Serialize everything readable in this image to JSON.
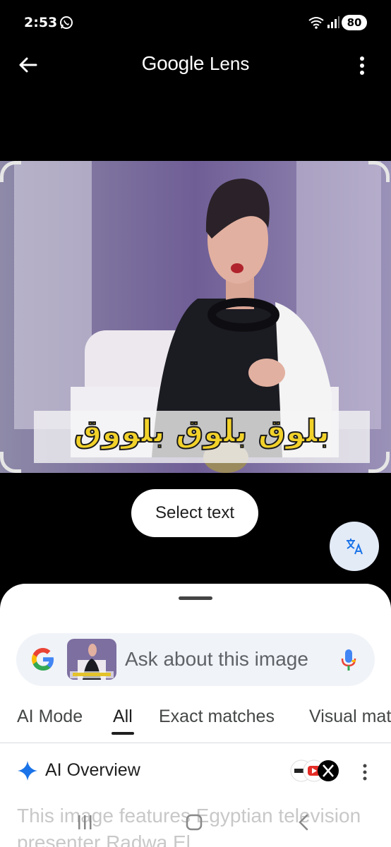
{
  "status_bar": {
    "time": "2:53",
    "battery": "80"
  },
  "app_bar": {
    "title_brand": "Google",
    "title_product": "Lens"
  },
  "image": {
    "caption": "بلوق بلوق بلووق"
  },
  "select_text_label": "Select text",
  "search": {
    "placeholder": "Ask about this image"
  },
  "tabs": [
    {
      "label": "AI Mode",
      "active": false
    },
    {
      "label": "All",
      "active": true
    },
    {
      "label": "Exact matches",
      "active": false
    },
    {
      "label": "Visual matches",
      "active": false
    }
  ],
  "ai_overview": {
    "title": "AI Overview",
    "text": "This image features Egyptian television presenter Radwa El"
  },
  "colors": {
    "accent_blue": "#1a73e8",
    "sheet_bg": "#ffffff",
    "search_bg": "#f0f3f8",
    "caption_yellow": "#f2d22a"
  },
  "icons": [
    "whatsapp-icon",
    "wifi-icon",
    "signal-icon",
    "back-arrow-icon",
    "more-vert-icon",
    "translate-icon",
    "google-g-icon",
    "mic-icon",
    "sparkle-icon",
    "recents-icon",
    "home-icon",
    "nav-back-icon"
  ]
}
